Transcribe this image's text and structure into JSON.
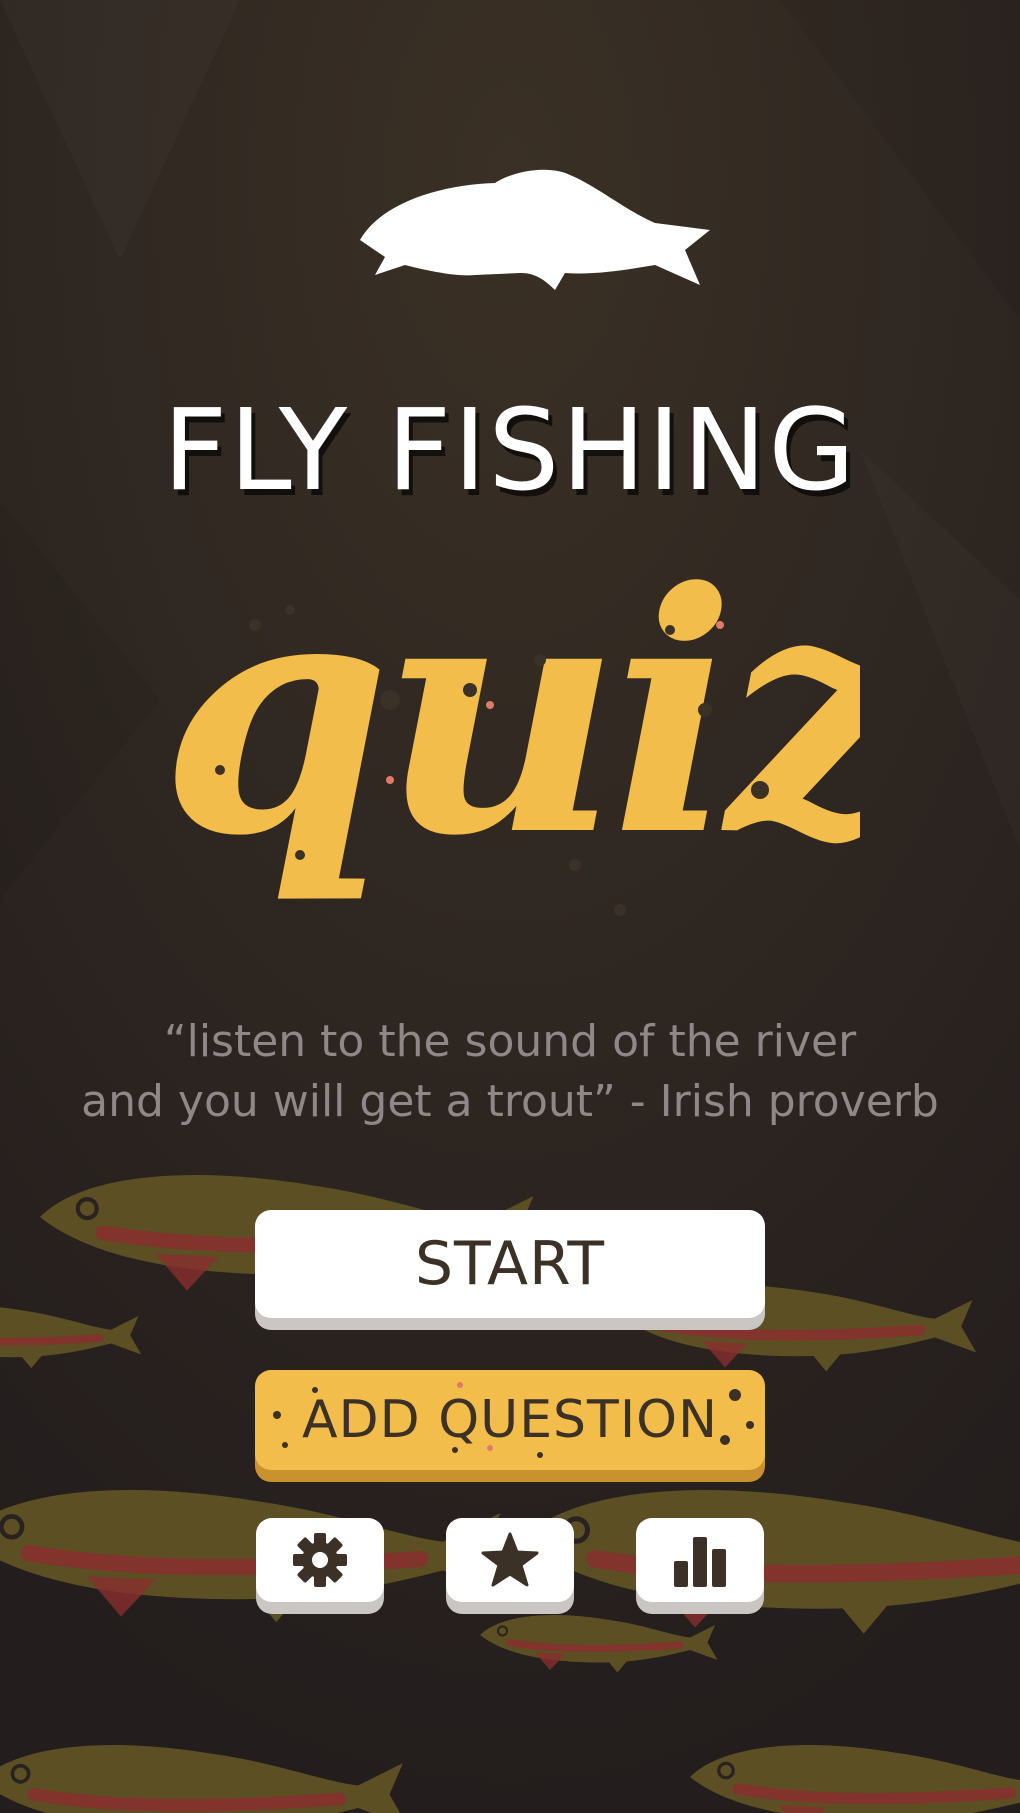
{
  "app": {
    "title_line": "FLY FISHING",
    "title_script": "quiz"
  },
  "quote": {
    "line1": "“listen to the sound of the river",
    "line2": "and you will get a trout” - Irish proverb"
  },
  "buttons": {
    "start_label": "START",
    "add_question_label": "ADD QUESTION",
    "settings_icon": "gear-icon",
    "favorites_icon": "star-icon",
    "stats_icon": "bar-chart-icon"
  },
  "colors": {
    "background": "#2a2220",
    "accent_yellow": "#f2bd4a",
    "button_text": "#3b3127",
    "quote_text": "#8f8788"
  }
}
